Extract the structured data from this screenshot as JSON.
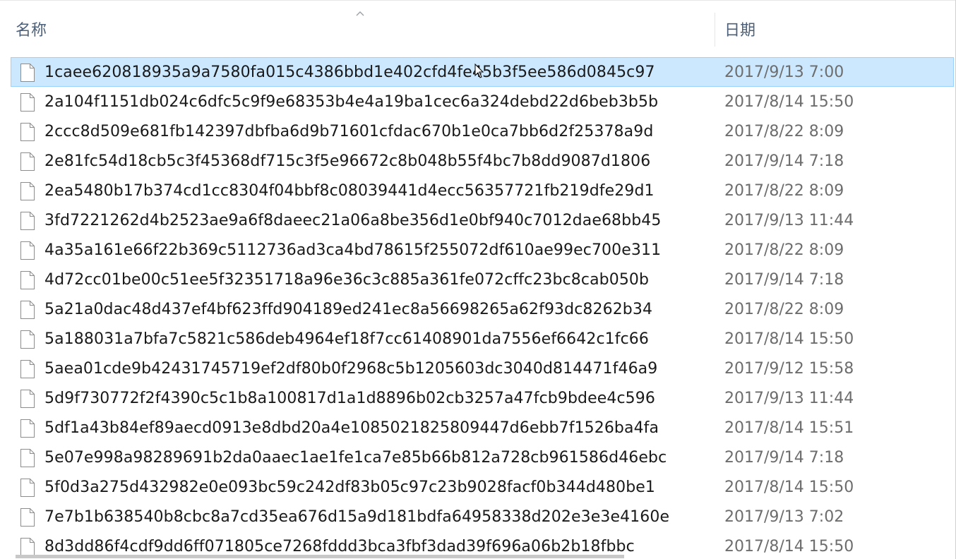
{
  "columns": {
    "name_label": "名称",
    "date_label": "日期",
    "sort_indicator": "chevron-up-icon"
  },
  "files": [
    {
      "name": "1caee620818935a9a7580fa015c4386bbd1e402cfd4fe45b3f5ee586d0845c97",
      "date": "2017/9/13 7:00",
      "selected": true
    },
    {
      "name": "2a104f1151db024c6dfc5c9f9e68353b4e4a19ba1cec6a324debd22d6beb3b5b",
      "date": "2017/8/14 15:50",
      "selected": false
    },
    {
      "name": "2ccc8d509e681fb142397dbfba6d9b71601cfdac670b1e0ca7bb6d2f25378a9d",
      "date": "2017/8/22 8:09",
      "selected": false
    },
    {
      "name": "2e81fc54d18cb5c3f45368df715c3f5e96672c8b048b55f4bc7b8dd9087d1806",
      "date": "2017/9/14 7:18",
      "selected": false
    },
    {
      "name": "2ea5480b17b374cd1cc8304f04bbf8c08039441d4ecc56357721fb219dfe29d1",
      "date": "2017/8/22 8:09",
      "selected": false
    },
    {
      "name": "3fd7221262d4b2523ae9a6f8daeec21a06a8be356d1e0bf940c7012dae68bb45",
      "date": "2017/9/13 11:44",
      "selected": false
    },
    {
      "name": "4a35a161e66f22b369c5112736ad3ca4bd78615f255072df610ae99ec700e311",
      "date": "2017/8/22 8:09",
      "selected": false
    },
    {
      "name": "4d72cc01be00c51ee5f32351718a96e36c3c885a361fe072cffc23bc8cab050b",
      "date": "2017/9/14 7:18",
      "selected": false
    },
    {
      "name": "5a21a0dac48d437ef4bf623ffd904189ed241ec8a56698265a62f93dc8262b34",
      "date": "2017/8/22 8:09",
      "selected": false
    },
    {
      "name": "5a188031a7bfa7c5821c586deb4964ef18f7cc61408901da7556ef6642c1fc66",
      "date": "2017/8/14 15:50",
      "selected": false
    },
    {
      "name": "5aea01cde9b42431745719ef2df80b0f2968c5b1205603dc3040d814471f46a9",
      "date": "2017/9/12 15:58",
      "selected": false
    },
    {
      "name": "5d9f730772f2f4390c5c1b8a100817d1a1d8896b02cb3257a47fcb9bdee4c596",
      "date": "2017/9/13 11:44",
      "selected": false
    },
    {
      "name": "5df1a43b84ef89aecd0913e8dbd20a4e1085021825809447d6ebb7f1526ba4fa",
      "date": "2017/8/14 15:51",
      "selected": false
    },
    {
      "name": "5e07e998a98289691b2da0aaec1ae1fe1ca7e85b66b812a728cb961586d46ebc",
      "date": "2017/9/14 7:18",
      "selected": false
    },
    {
      "name": "5f0d3a275d432982e0e093bc59c242df83b05c97c23b9028facf0b344d480be1",
      "date": "2017/8/14 15:50",
      "selected": false
    },
    {
      "name": "7e7b1b638540b8cbc8a7cd35ea676d15a9d181bdfa64958338d202e3e3e4160e",
      "date": "2017/9/13 7:02",
      "selected": false
    },
    {
      "name": "8d3dd86f4cdf9dd6ff071805ce7268fddd3bca3fbf3dad39f696a06b2b18fbbc",
      "date": "2017/8/14 15:50",
      "selected": false
    }
  ],
  "icons": {
    "file": "file-icon",
    "cursor": "mouse-cursor-icon"
  },
  "colors": {
    "selection_fill": "#cce8ff",
    "selection_border": "#99d1ff",
    "header_text": "#4c607a",
    "date_text": "#6d6d6d"
  }
}
